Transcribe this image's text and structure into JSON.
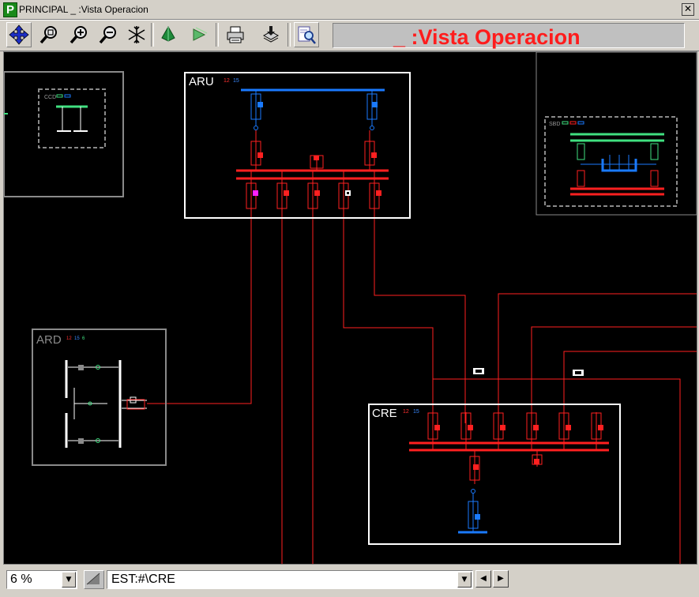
{
  "window": {
    "title": "PRINCIPAL _ :Vista Operacion",
    "app_icon": "P",
    "close_symbol": "✕"
  },
  "toolbar": {
    "buttons": [
      "pan-icon",
      "zoom-window-icon",
      "zoom-in-icon",
      "zoom-out-icon",
      "freeze-icon",
      "layer-up-icon",
      "layer-down-icon",
      "print-icon",
      "save-icon",
      "search-view-icon"
    ],
    "view_title": "_ :Vista Operacion"
  },
  "diagram": {
    "stations": [
      {
        "id": "ARU",
        "label": "ARU",
        "voltages": [
          "12",
          "15"
        ]
      },
      {
        "id": "ARD",
        "label": "ARD",
        "voltages": [
          "12",
          "15",
          "6"
        ]
      },
      {
        "id": "CRE",
        "label": "CRE",
        "voltages": [
          "12",
          "15"
        ]
      },
      {
        "id": "CCD",
        "label": "CCD"
      },
      {
        "id": "SBD",
        "label": "SBD"
      }
    ]
  },
  "statusbar": {
    "zoom": "6 %",
    "station_field": "EST:#\\CRE",
    "left_arrow": "◀",
    "right_arrow": "▶",
    "dropdown_arrow": "▼"
  },
  "colors": {
    "line_red": "#ff2020",
    "bus_blue": "#1a7aff",
    "bus_green": "#40e080",
    "frame_white": "#ffffff",
    "frame_gray": "#8a8a8a",
    "title_red": "#ff1c1c"
  }
}
